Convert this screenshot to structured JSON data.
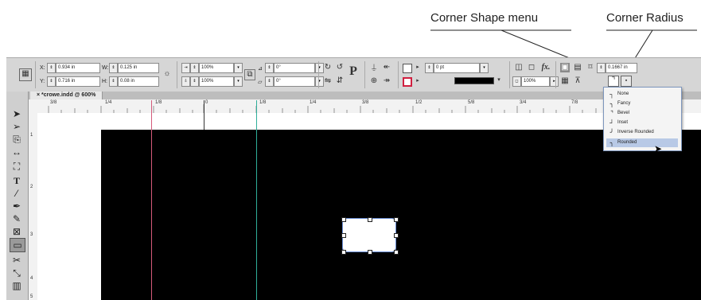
{
  "callouts": {
    "corner_shape_menu": "Corner Shape menu",
    "corner_radius": "Corner Radius"
  },
  "control_panel": {
    "x": {
      "label": "X:",
      "value": "0.934 in"
    },
    "y": {
      "label": "Y:",
      "value": "0.716 in"
    },
    "w": {
      "label": "W:",
      "value": "0.125 in"
    },
    "h": {
      "label": "H:",
      "value": "0.08 in"
    },
    "scale_x": "100%",
    "scale_y": "100%",
    "rotation": "0°",
    "shear": "0°",
    "stroke_weight": "0 pt",
    "opacity": "100%",
    "corner_radius_value": "0.1667 in",
    "icons": [
      "reference-point-icon",
      "constrain-proportions-icon",
      "rotate-cw-icon",
      "rotate-ccw-icon",
      "flip-horizontal-icon",
      "fill-icon",
      "stroke-icon",
      "fx-icon",
      "corner-shape-icon"
    ]
  },
  "document": {
    "tab_title": "*crowe.indd @ 600%"
  },
  "ruler": {
    "h_ticks": [
      "3/8",
      "1/4",
      "1/8",
      "0",
      "1/8",
      "1/4",
      "3/8",
      "1/2",
      "5/8",
      "3/4",
      "7/8"
    ],
    "v_ticks": [
      "1",
      "2",
      "3",
      "4",
      "5"
    ]
  },
  "tools": [
    "selection-tool",
    "direct-selection-tool",
    "page-tool",
    "gap-tool",
    "content-collector-tool",
    "type-tool",
    "line-tool",
    "pen-tool",
    "pencil-tool",
    "rectangle-frame-tool",
    "rectangle-tool",
    "scissors-tool",
    "free-transform-tool",
    "gradient-tool"
  ],
  "corner_menu": {
    "items": [
      {
        "label": "None",
        "icon": "┐"
      },
      {
        "label": "Fancy",
        "icon": "╮"
      },
      {
        "label": "Bevel",
        "icon": "⌝"
      },
      {
        "label": "Inset",
        "icon": "┘"
      },
      {
        "label": "Inverse Rounded",
        "icon": "╯"
      },
      {
        "label": "Rounded",
        "icon": "╮"
      }
    ],
    "selected": "Rounded"
  }
}
